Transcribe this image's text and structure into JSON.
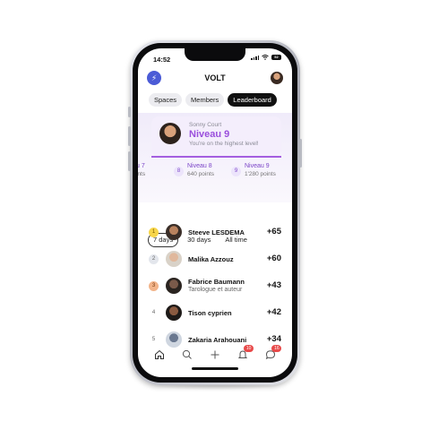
{
  "status_bar": {
    "time": "14:52",
    "battery": "52"
  },
  "header": {
    "title": "VOLT"
  },
  "tabs": [
    {
      "label": "Spaces",
      "active": false
    },
    {
      "label": "Members",
      "active": false
    },
    {
      "label": "Leaderboard",
      "active": true
    }
  ],
  "hero": {
    "name": "Sonny Court",
    "level": "Niveau 9",
    "message": "You're on the highest level!"
  },
  "levels": [
    {
      "num": "",
      "title": "u 7",
      "points": "ints"
    },
    {
      "num": "8",
      "title": "Niveau 8",
      "points": "640 points"
    },
    {
      "num": "9",
      "title": "Niveau 9",
      "points": "1'280 points"
    }
  ],
  "filters": [
    {
      "label": "7 days",
      "active": true
    },
    {
      "label": "30 days",
      "active": false
    },
    {
      "label": "All time",
      "active": false
    }
  ],
  "leaderboard": [
    {
      "rank": "1",
      "name": "Steeve LESDEMA",
      "subtitle": "",
      "score": "+65"
    },
    {
      "rank": "2",
      "name": "Malika Azzouz",
      "subtitle": "",
      "score": "+60"
    },
    {
      "rank": "3",
      "name": "Fabrice Baumann",
      "subtitle": "Tarologue et auteur",
      "score": "+43"
    },
    {
      "rank": "4",
      "name": "Tison cyprien",
      "subtitle": "",
      "score": "+42"
    },
    {
      "rank": "5",
      "name": "Zakaria Arahouani",
      "subtitle": "",
      "score": "+34"
    }
  ],
  "bottom_nav": {
    "home_icon": "home-icon",
    "search_icon": "search-icon",
    "add_icon": "plus-icon",
    "notifications_icon": "bell-icon",
    "notifications_badge": "10",
    "messages_icon": "chat-icon",
    "messages_badge": "16"
  },
  "colors": {
    "accent": "#9a4fdc",
    "logo": "#4b5bd6",
    "badge": "#e84a4a"
  }
}
